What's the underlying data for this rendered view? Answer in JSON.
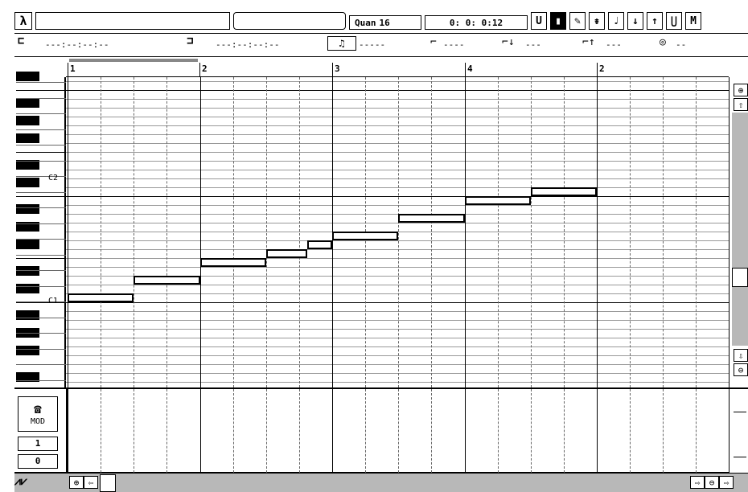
{
  "toolbar": {
    "pointer_glyph": "λ",
    "quantize_label": "Quan",
    "quantize_value": "16",
    "position": "0:  0:  0:12",
    "tools": [
      {
        "name": "u-tool",
        "glyph": "U",
        "selected": false
      },
      {
        "name": "select-tool",
        "glyph": "▮",
        "selected": true
      },
      {
        "name": "pencil-tool",
        "glyph": "✎",
        "selected": false
      },
      {
        "name": "eraser-tool",
        "glyph": "⇟",
        "selected": false
      },
      {
        "name": "note-tool",
        "glyph": "♩",
        "selected": false
      },
      {
        "name": "down-tool",
        "glyph": "↓",
        "selected": false
      },
      {
        "name": "up-tool",
        "glyph": "↑",
        "selected": false
      },
      {
        "name": "cup-tool",
        "glyph": "⋃",
        "selected": false
      },
      {
        "name": "mute-tool",
        "glyph": "M",
        "selected": false
      }
    ]
  },
  "info_bar": {
    "field1": "---:--:--:--",
    "field2": "---:--:--:--",
    "field3": "-----",
    "field4": "----",
    "field5": "---",
    "field6": "---",
    "field7": "--"
  },
  "ruler": {
    "markers": [
      "1",
      "2",
      "3",
      "4",
      "2"
    ]
  },
  "keyboard": {
    "labels": [
      "C2",
      "C1"
    ]
  },
  "notes": [
    {
      "start": 0.0,
      "length": 0.5,
      "pitch": 60
    },
    {
      "start": 0.5,
      "length": 0.5,
      "pitch": 62
    },
    {
      "start": 1.0,
      "length": 0.5,
      "pitch": 64
    },
    {
      "start": 1.5,
      "length": 0.3125,
      "pitch": 65
    },
    {
      "start": 1.8125,
      "length": 0.1875,
      "pitch": 66
    },
    {
      "start": 2.0,
      "length": 0.5,
      "pitch": 67
    },
    {
      "start": 2.5,
      "length": 0.5,
      "pitch": 69
    },
    {
      "start": 3.0,
      "length": 0.5,
      "pitch": 71
    },
    {
      "start": 3.5,
      "length": 0.5,
      "pitch": 72
    }
  ],
  "controller": {
    "label": "MOD",
    "value1": "1",
    "value2": "0"
  },
  "icons": [
    "tempo-icon",
    "zoom-in-icon",
    "zoom-out-icon",
    "scroll-up-icon",
    "scroll-down-icon"
  ]
}
